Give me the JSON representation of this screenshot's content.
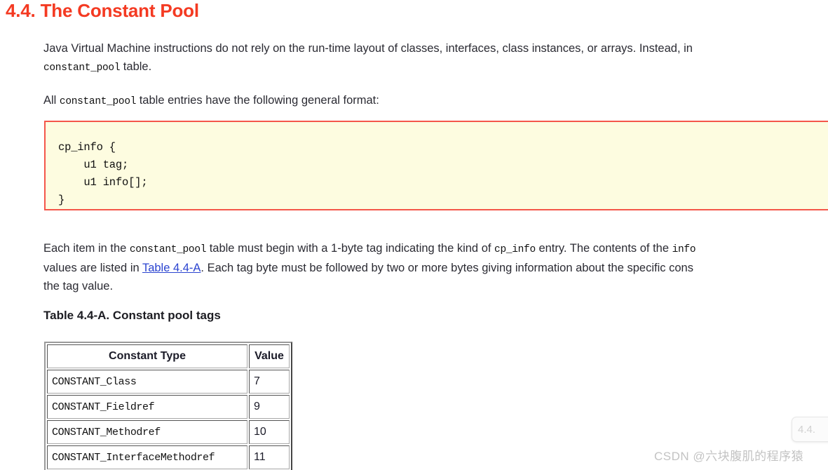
{
  "heading": {
    "number": "4.4.",
    "title": "The Constant Pool",
    "full": "4.4. The Constant Pool",
    "color": "#f43a22"
  },
  "paragraphs": {
    "intro": {
      "line1": "Java Virtual Machine instructions do not rely on the run-time layout of classes, interfaces, class instances, or arrays. Instead, in",
      "line2_code": "constant_pool",
      "line2_rest": " table."
    },
    "format_intro": {
      "pre": "All ",
      "code": "constant_pool",
      "post": " table entries have the following general format:"
    },
    "each_item": {
      "l1_a": "Each item in the ",
      "l1_code1": "constant_pool",
      "l1_b": " table must begin with a 1-byte tag indicating the kind of ",
      "l1_code2": "cp_info",
      "l1_c": " entry. The contents of the ",
      "l1_code3": "info",
      "l2_a": "values are listed in ",
      "l2_link": "Table 4.4-A",
      "l2_b": ". Each tag byte must be followed by two or more bytes giving information about the specific cons",
      "l3": "the tag value."
    }
  },
  "codebox": {
    "background": "#fdfce0",
    "border_color": "#f4564a",
    "content": "cp_info {\n    u1 tag;\n    u1 info[];\n}"
  },
  "table": {
    "caption": "Table 4.4-A. Constant pool tags",
    "columns": [
      "Constant Type",
      "Value"
    ],
    "rows": [
      {
        "type": "CONSTANT_Class",
        "value": "7"
      },
      {
        "type": "CONSTANT_Fieldref",
        "value": "9"
      },
      {
        "type": "CONSTANT_Methodref",
        "value": "10"
      },
      {
        "type": "CONSTANT_InterfaceMethodref",
        "value": "11"
      }
    ]
  },
  "float_widget": {
    "label": "4.4."
  },
  "watermark": {
    "text": "CSDN @六块腹肌的程序猿"
  }
}
